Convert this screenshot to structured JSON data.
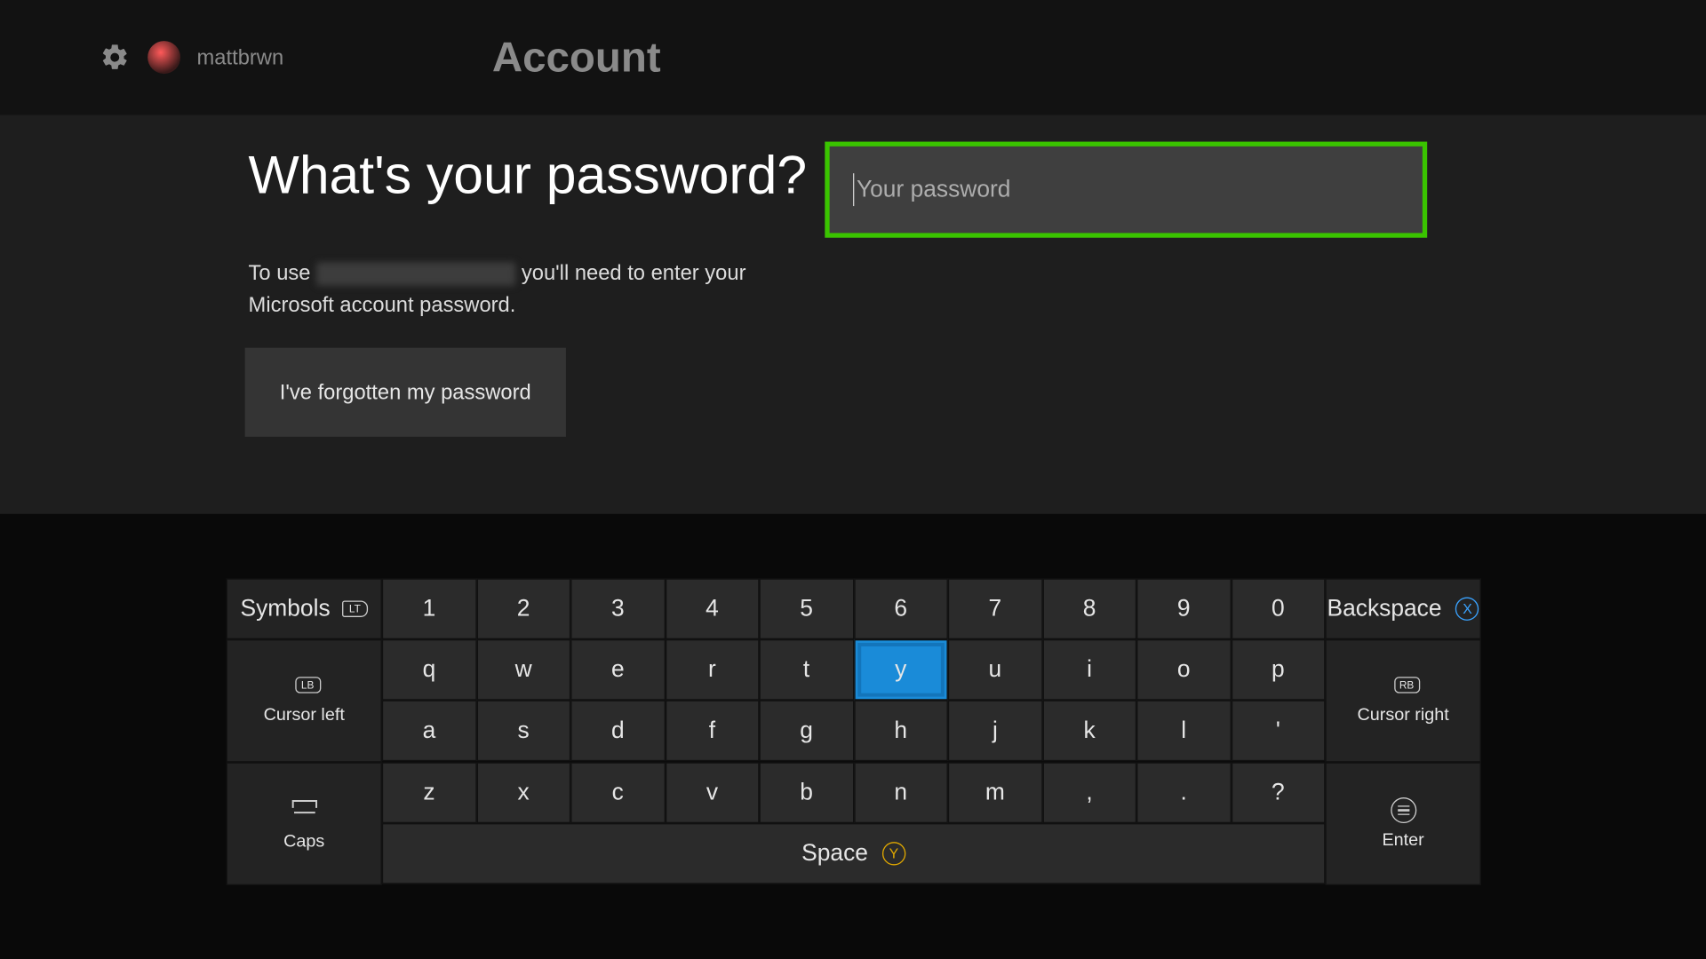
{
  "header": {
    "username": "mattbrwn",
    "page_title": "Account"
  },
  "main": {
    "heading": "What's your password?",
    "subtext_pre": "To use ",
    "subtext_post": " you'll need to enter your Microsoft account password.",
    "forgot_button": "I've forgotten my password",
    "password_placeholder": "Your password"
  },
  "keyboard": {
    "symbols": "Symbols",
    "backspace": "Backspace",
    "cursor_left": "Cursor left",
    "cursor_right": "Cursor right",
    "caps": "Caps",
    "enter": "Enter",
    "space": "Space",
    "row1": [
      "1",
      "2",
      "3",
      "4",
      "5",
      "6",
      "7",
      "8",
      "9",
      "0"
    ],
    "row2": [
      "q",
      "w",
      "e",
      "r",
      "t",
      "y",
      "u",
      "i",
      "o",
      "p"
    ],
    "row3": [
      "a",
      "s",
      "d",
      "f",
      "g",
      "h",
      "j",
      "k",
      "l",
      "'"
    ],
    "row4": [
      "z",
      "x",
      "c",
      "v",
      "b",
      "n",
      "m",
      ",",
      ".",
      "?"
    ],
    "selected_key": "y",
    "badges": {
      "lt": "LT",
      "lb": "LB",
      "rb": "RB",
      "x": "X",
      "y": "Y"
    }
  }
}
